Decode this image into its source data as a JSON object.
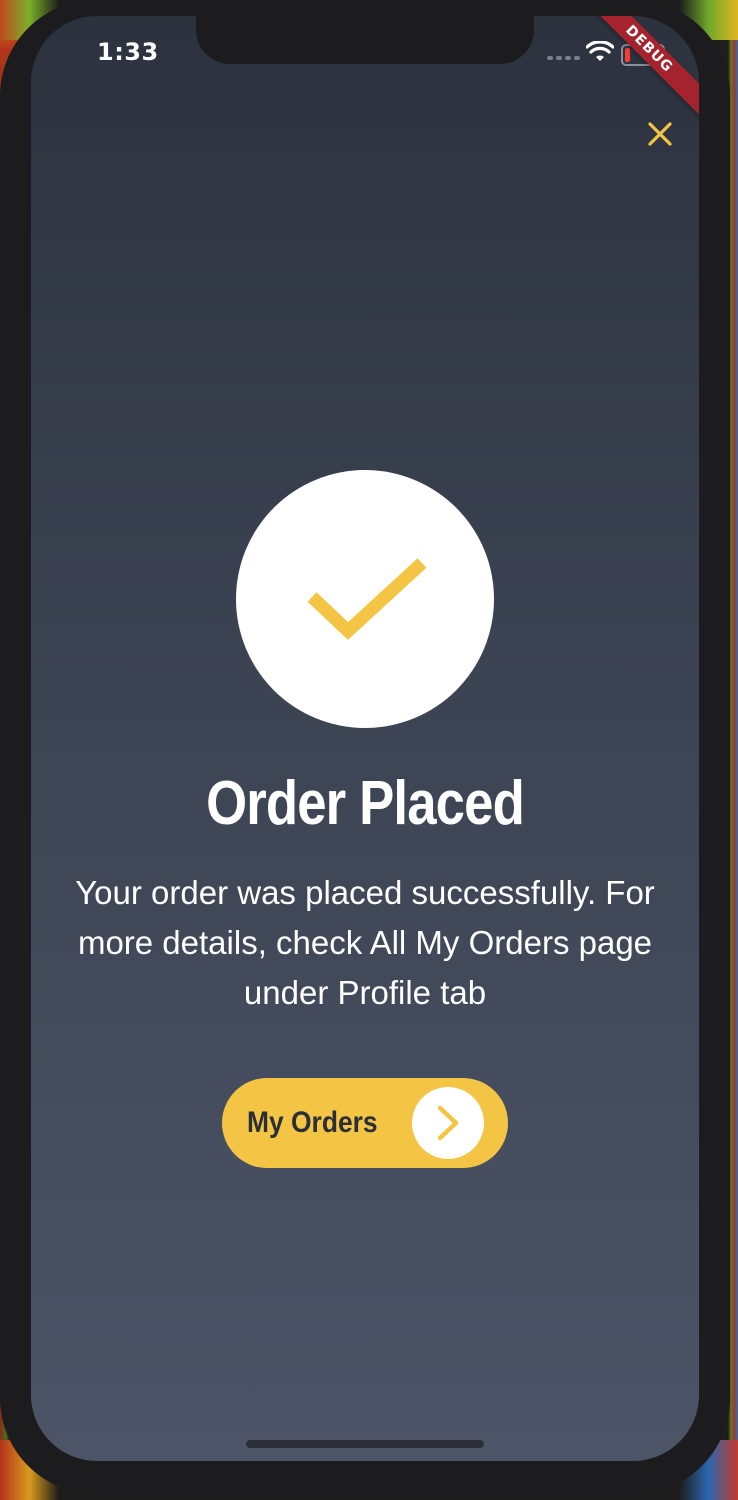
{
  "status_bar": {
    "time": "1:33",
    "wifi_icon": "wifi-icon",
    "battery_icon": "battery-low-icon"
  },
  "debug_banner": "DEBUG",
  "close_icon": "close-icon",
  "success_icon": "checkmark-icon",
  "title": "Order Placed",
  "message": "Your order was placed successfully. For more details, check All My Orders page under Profile tab",
  "button": {
    "label": "My Orders",
    "icon": "chevron-right-icon"
  },
  "colors": {
    "accent": "#f4c545",
    "background_top": "#2c323e",
    "background_bottom": "#4c5567",
    "text": "#ffffff"
  }
}
